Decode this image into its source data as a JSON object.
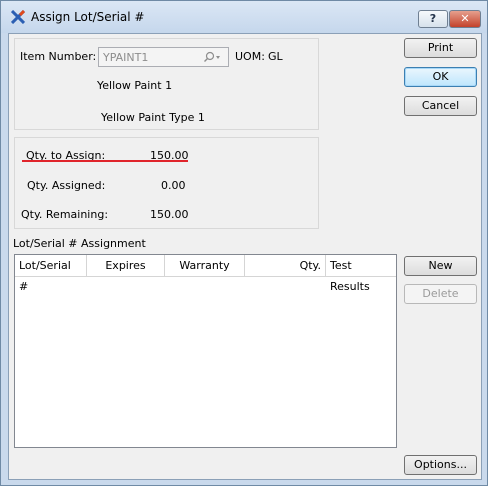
{
  "window": {
    "title": "Assign Lot/Serial #",
    "help_label": "?",
    "close_label": "✕"
  },
  "item": {
    "number_label": "Item Number:",
    "number_value": "YPAINT1",
    "uom_label": "UOM:",
    "uom_value": "GL",
    "description1": "Yellow Paint 1",
    "description2": "Yellow Paint Type 1"
  },
  "quantities": {
    "to_assign_label": "Qty. to Assign:",
    "to_assign_value": "150.00",
    "assigned_label": "Qty. Assigned:",
    "assigned_value": "0.00",
    "remaining_label": "Qty. Remaining:",
    "remaining_value": "150.00"
  },
  "assignment": {
    "section_label": "Lot/Serial # Assignment",
    "columns": [
      "Lot/Serial #",
      "Expires",
      "Warranty",
      "Qty.",
      "Test Results"
    ],
    "rows": []
  },
  "buttons": {
    "print": "Print",
    "ok": "OK",
    "cancel": "Cancel",
    "new": "New",
    "delete": "Delete",
    "options": "Options..."
  },
  "colors": {
    "highlight_underline": "#e0242b",
    "title_bar": "#c9d9ec",
    "close_button": "#c3412a"
  }
}
